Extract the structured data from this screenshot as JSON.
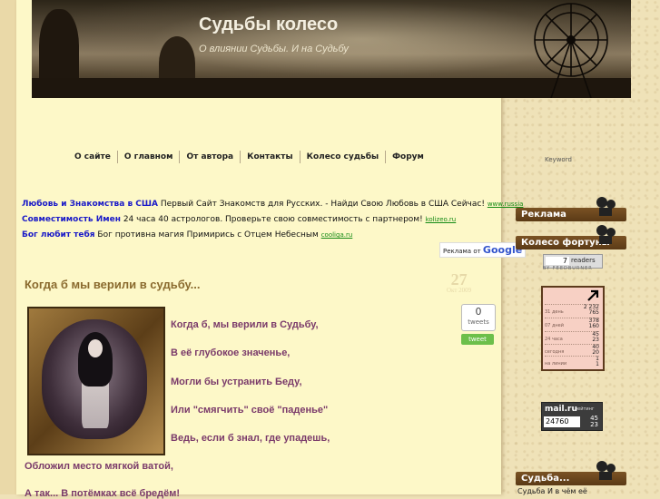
{
  "header": {
    "title": "Судьбы колесо",
    "subtitle": "О влиянии Судьбы. И на Судьбу"
  },
  "nav": {
    "items": [
      "О сайте",
      "О главном",
      "От автора",
      "Контакты",
      "Колесо судьбы",
      "Форум"
    ]
  },
  "ads": {
    "rows": [
      {
        "title": "Любовь и Знакомства в США",
        "text": "Первый Сайт Знакомств для Русских. - Найди Свою Любовь в США Сейчас!",
        "url": "www.russia"
      },
      {
        "title": "Совместимость Имен",
        "text": "24 часа 40 астрологов. Проверьте свою совместимость с партнером!",
        "url": "kolizeo.ru"
      },
      {
        "title": "Бог любит тебя",
        "text": "Бог противна магия Примирись с Отцем Небесным",
        "url": "cooliga.ru"
      }
    ],
    "ads_by": "Реклама от",
    "ads_brand": "Google"
  },
  "post": {
    "title": "Когда б мы верили в судьбу...",
    "date_day": "27",
    "date_month": "Окт 2009",
    "poem": [
      "Когда б, мы верили в Судьбу,",
      "В её глубокое значенье,",
      "Могли бы устранить Беду,",
      "Или \"смягчить\" своё \"паденье\"",
      "Ведь, если б знал, где упадешь,",
      "Обложил место мягкой ватой,",
      "А так... В потёмках всё бредём!"
    ],
    "tweet_count": "0",
    "tweet_label": "tweets",
    "tweet_button": "tweet"
  },
  "sidebar": {
    "keyword": "Keyword",
    "widgets": [
      "Реклама",
      "Колесо фортуны",
      "Судьба..."
    ],
    "feedburner": {
      "count": "7",
      "label": "readers",
      "by": "BY FEEDBURNER"
    },
    "counter": {
      "rows": [
        {
          "label": "31 день",
          "values": [
            "2 232",
            "765"
          ]
        },
        {
          "label": "07 дней",
          "values": [
            "378",
            "160"
          ]
        },
        {
          "label": "24 часа",
          "values": [
            "45",
            "23"
          ]
        },
        {
          "label": "сегодня",
          "values": [
            "40",
            "20"
          ]
        },
        {
          "label": "на линии",
          "values": [
            "1",
            "1"
          ]
        }
      ]
    },
    "mailru": {
      "logo": "mail.ru",
      "sub": "рейтинг",
      "count": "24760",
      "r1": "45",
      "r2": "23"
    },
    "bottom_text": "Судьба И в чём её"
  },
  "colors": {
    "accent": "#7a3a6a",
    "post_title": "#8a6a2e",
    "widget_head": "#6a4520",
    "ad_link": "#1a1ac8",
    "ad_url": "#148a14"
  }
}
